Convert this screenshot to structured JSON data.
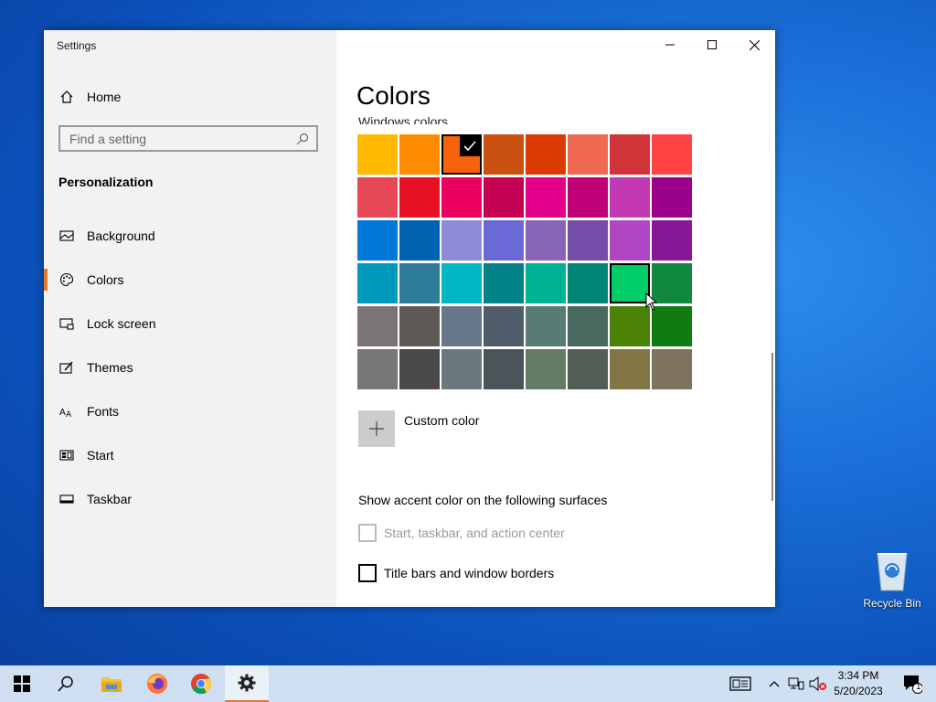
{
  "window": {
    "title": "Settings"
  },
  "sidebar": {
    "home": "Home",
    "search_placeholder": "Find a setting",
    "section": "Personalization",
    "items": [
      {
        "label": "Background",
        "icon": "picture-icon"
      },
      {
        "label": "Colors",
        "icon": "palette-icon",
        "active": true
      },
      {
        "label": "Lock screen",
        "icon": "lock-screen-icon"
      },
      {
        "label": "Themes",
        "icon": "themes-icon"
      },
      {
        "label": "Fonts",
        "icon": "fonts-icon"
      },
      {
        "label": "Start",
        "icon": "start-icon"
      },
      {
        "label": "Taskbar",
        "icon": "taskbar-icon"
      }
    ]
  },
  "content": {
    "title": "Colors",
    "subtitle": "Windows colors",
    "selected_swatch_index": 2,
    "hovered_swatch_index": 30,
    "colors": [
      "#FFB900",
      "#FF8C00",
      "#F7630C",
      "#CA5010",
      "#DA3B01",
      "#EF6950",
      "#D13438",
      "#FF4343",
      "#E74856",
      "#E81123",
      "#EA005E",
      "#C30052",
      "#E3008C",
      "#BF0077",
      "#C239B3",
      "#9A0089",
      "#0078D7",
      "#0063B1",
      "#8E8CD8",
      "#6B69D6",
      "#8764B8",
      "#744DA9",
      "#B146C2",
      "#881798",
      "#0099BC",
      "#2D7D9A",
      "#00B7C3",
      "#038387",
      "#00B294",
      "#018574",
      "#00CC6A",
      "#10893E",
      "#7A7574",
      "#5D5A58",
      "#68768A",
      "#515C6B",
      "#567C73",
      "#486860",
      "#498205",
      "#107C10",
      "#767676",
      "#4C4A48",
      "#69797E",
      "#4A5459",
      "#647C64",
      "#525E54",
      "#847545",
      "#7E735F"
    ],
    "custom_color_label": "Custom color",
    "surfaces_title": "Show accent color on the following surfaces",
    "checkbox_start": "Start, taskbar, and action center",
    "checkbox_titlebars": "Title bars and window borders"
  },
  "taskbar": {
    "time": "3:34 PM",
    "date": "5/20/2023",
    "notification_count": "1",
    "accent": "#e8762d"
  },
  "desktop": {
    "recycle_bin": "Recycle Bin"
  }
}
